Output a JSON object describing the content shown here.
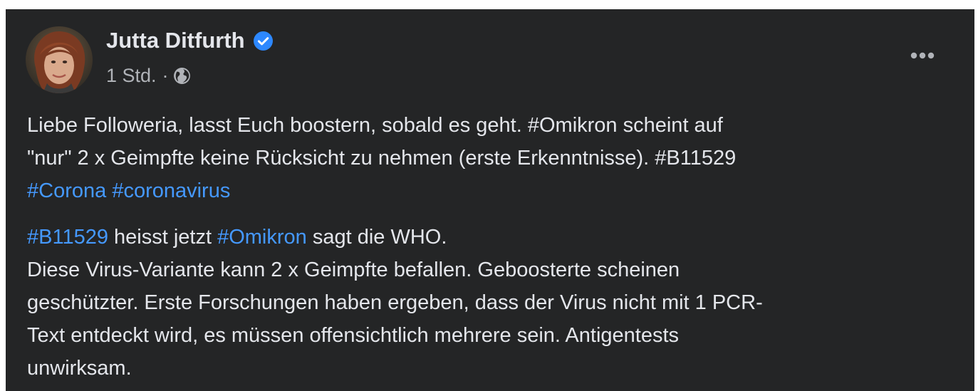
{
  "post": {
    "author_name": "Jutta Ditfurth",
    "timestamp": "1 Std.",
    "separator": "·",
    "audience_icon": "globe-icon",
    "verified_icon": "verified-badge-icon",
    "more_icon": "more-options-icon",
    "paragraph1": {
      "line1": "Liebe Followeria, lasst Euch boostern, sobald es geht. #Omikron scheint auf",
      "line2": "\"nur\" 2 x Geimpfte keine Rücksicht zu nehmen (erste Erkenntnisse). #B11529",
      "hashtag1": "#Corona",
      "hashtag2": "#coronavirus"
    },
    "paragraph2": {
      "hashtag1": "#B11529",
      "text1": " heisst jetzt ",
      "hashtag2": "#Omikron",
      "text2": " sagt die WHO.",
      "line2": "Diese Virus-Variante kann 2 x Geimpfte befallen. Geboosterte scheinen",
      "line3": "geschützter. Erste Forschungen haben ergeben, dass der Virus nicht mit 1 PCR-",
      "line4": "Text entdeckt wird, es müssen offensichtlich mehrere sein. Antigentests",
      "line5": "unwirksam."
    }
  },
  "colors": {
    "background": "#242526",
    "text": "#e4e6eb",
    "secondary_text": "#b0b3b8",
    "hashtag": "#4599ff",
    "verified": "#2d88ff"
  }
}
